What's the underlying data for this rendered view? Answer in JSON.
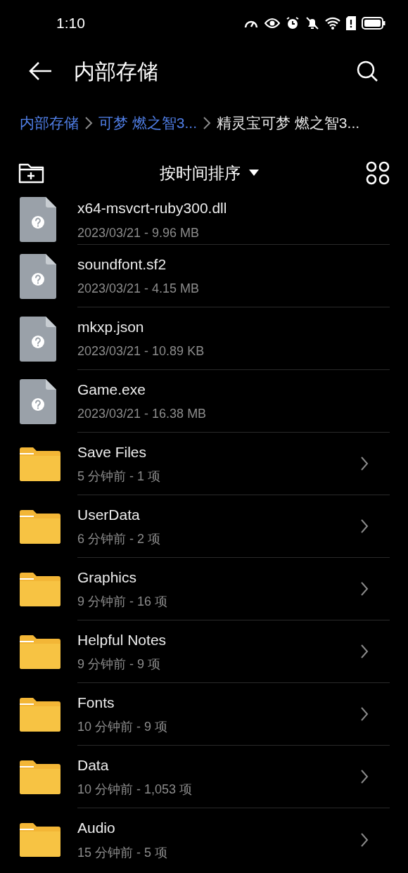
{
  "status_bar": {
    "time": "1:10"
  },
  "header": {
    "title": "内部存储"
  },
  "breadcrumb": [
    {
      "label": "内部存储",
      "current": false
    },
    {
      "label": "可梦 燃之智3...",
      "current": false
    },
    {
      "label": "精灵宝可梦 燃之智3...",
      "current": true
    }
  ],
  "toolbar": {
    "sort": "按时间排序"
  },
  "files": [
    {
      "kind": "file",
      "name": "x64-msvcrt-ruby300.dll",
      "meta": "2023/03/21 - 9.96 MB"
    },
    {
      "kind": "file",
      "name": "soundfont.sf2",
      "meta": "2023/03/21 - 4.15 MB"
    },
    {
      "kind": "file",
      "name": "mkxp.json",
      "meta": "2023/03/21 - 10.89 KB"
    },
    {
      "kind": "file",
      "name": "Game.exe",
      "meta": "2023/03/21 - 16.38 MB"
    },
    {
      "kind": "folder",
      "name": "Save Files",
      "meta": "5 分钟前 - 1 项"
    },
    {
      "kind": "folder",
      "name": "UserData",
      "meta": "6 分钟前 - 2 项"
    },
    {
      "kind": "folder",
      "name": "Graphics",
      "meta": "9 分钟前 - 16 项"
    },
    {
      "kind": "folder",
      "name": "Helpful Notes",
      "meta": "9 分钟前 - 9 项"
    },
    {
      "kind": "folder",
      "name": "Fonts",
      "meta": "10 分钟前 - 9 项"
    },
    {
      "kind": "folder",
      "name": "Data",
      "meta": "10 分钟前 - 1,053 项"
    },
    {
      "kind": "folder",
      "name": "Audio",
      "meta": "15 分钟前 - 5 项"
    }
  ]
}
